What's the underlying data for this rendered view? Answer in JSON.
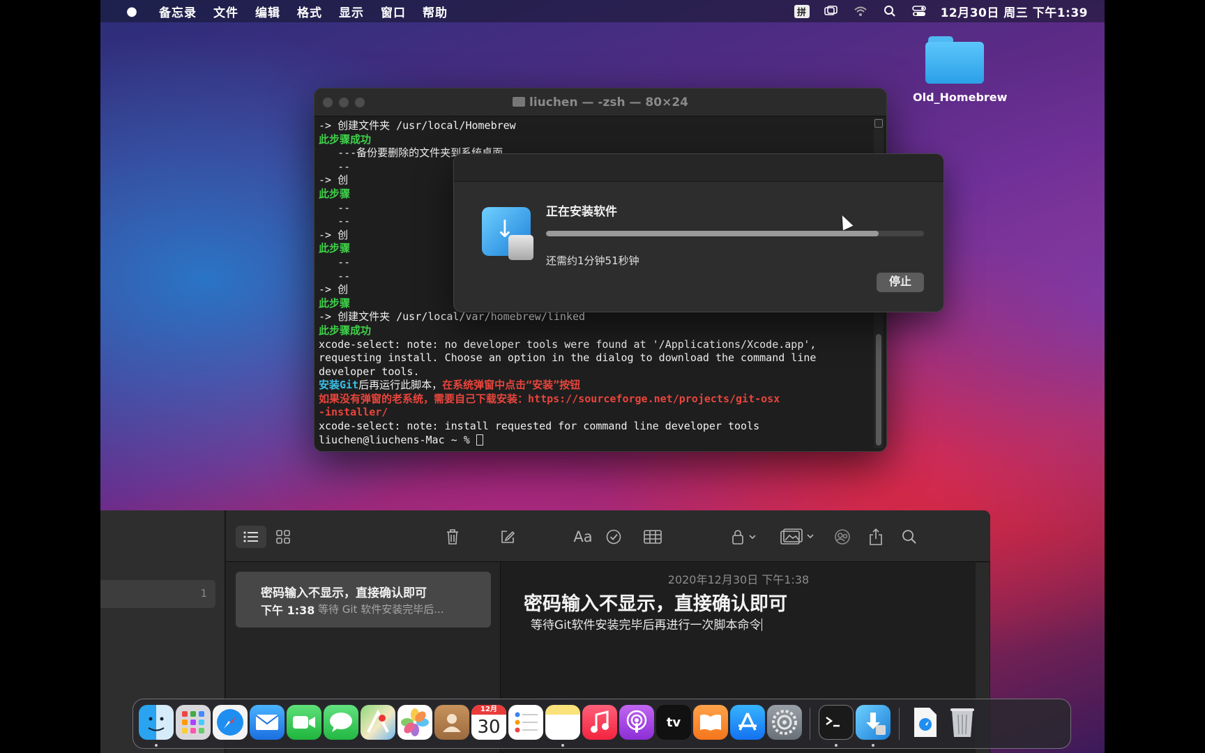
{
  "menubar": {
    "apple": "",
    "app_name": "备忘录",
    "menus": [
      "文件",
      "编辑",
      "格式",
      "显示",
      "窗口",
      "帮助"
    ],
    "input_method": "拼",
    "clock": "12月30日 周三 下午1:39",
    "status_icons": [
      "input-method-icon",
      "screen-mirroring-icon",
      "wifi-icon",
      "spotlight-search-icon",
      "control-center-icon"
    ]
  },
  "desktop": {
    "folder_label": "Old_Homebrew"
  },
  "terminal": {
    "title": "liuchen — -zsh — 80×24",
    "lines": [
      [
        {
          "t": "-> 创建文件夹 /usr/local/Homebrew",
          "c": "w"
        }
      ],
      [
        {
          "t": "此步骤成功",
          "c": "g"
        }
      ],
      [
        {
          "t": "   ---备份要删除的文件夹到系统桌面",
          "c": "w"
        }
      ],
      [
        {
          "t": "   --",
          "c": "w"
        }
      ],
      [
        {
          "t": "-> 创",
          "c": "w"
        }
      ],
      [
        {
          "t": "此步骤",
          "c": "g"
        }
      ],
      [
        {
          "t": "   --",
          "c": "w"
        }
      ],
      [
        {
          "t": "   --",
          "c": "w"
        }
      ],
      [
        {
          "t": "-> 创",
          "c": "w"
        }
      ],
      [
        {
          "t": "此步骤",
          "c": "g"
        }
      ],
      [
        {
          "t": "   --",
          "c": "w"
        }
      ],
      [
        {
          "t": "   --",
          "c": "w"
        }
      ],
      [
        {
          "t": "-> 创",
          "c": "w"
        }
      ],
      [
        {
          "t": "此步骤",
          "c": "g"
        }
      ],
      [
        {
          "t": "-> 创建文件夹 /usr/local/var/homebrew/linked",
          "c": "w"
        }
      ],
      [
        {
          "t": "此步骤成功",
          "c": "g"
        }
      ],
      [
        {
          "t": "xcode-select: note: no developer tools were found at '/Applications/Xcode.app',",
          "c": "w"
        }
      ],
      [
        {
          "t": "requesting install. Choose an option in the dialog to download the command line",
          "c": "w"
        }
      ],
      [
        {
          "t": "developer tools.",
          "c": "w"
        }
      ],
      [
        {
          "t": "安装Git",
          "c": "c"
        },
        {
          "t": "后再运行此脚本，",
          "c": "w"
        },
        {
          "t": "在系统弹窗中点击“安装”按钮",
          "c": "r"
        }
      ],
      [
        {
          "t": "如果没有弹窗的老系统，需要自己下载安装：https://sourceforge.net/projects/git-osx",
          "c": "r"
        }
      ],
      [
        {
          "t": "-installer/",
          "c": "r"
        }
      ],
      [
        {
          "t": "xcode-select: note: install requested for command line developer tools",
          "c": "w"
        }
      ],
      [
        {
          "t": "liuchen@liuchens-Mac ~ % ",
          "c": "w"
        }
      ]
    ]
  },
  "install_dialog": {
    "title": "正在安装软件",
    "progress": 0.88,
    "remaining": "还需约1分钟51秒钟",
    "stop_label": "停止"
  },
  "notes": {
    "folder_count": "1",
    "list_item": {
      "title": "密码输入不显示，直接确认即可",
      "time": "下午 1:38",
      "preview": "等待 Git 软件安装完毕后..."
    },
    "editor": {
      "date": "2020年12月30日 下午1:38",
      "heading": "密码输入不显示，直接确认即可",
      "body": "等待Git软件安装完毕后再进行一次脚本命令"
    },
    "toolbar": {
      "format_label": "Aa"
    }
  },
  "dock": {
    "calendar_month": "12月",
    "calendar_day": "30",
    "tv_label": "tv",
    "apps": [
      "finder",
      "launchpad",
      "safari",
      "mail",
      "facetime",
      "messages",
      "maps",
      "photos",
      "contacts",
      "calendar",
      "reminders",
      "notes",
      "music",
      "podcasts",
      "apple-tv",
      "books",
      "app-store",
      "system-preferences",
      "terminal",
      "installer",
      "downloads",
      "trash"
    ]
  }
}
